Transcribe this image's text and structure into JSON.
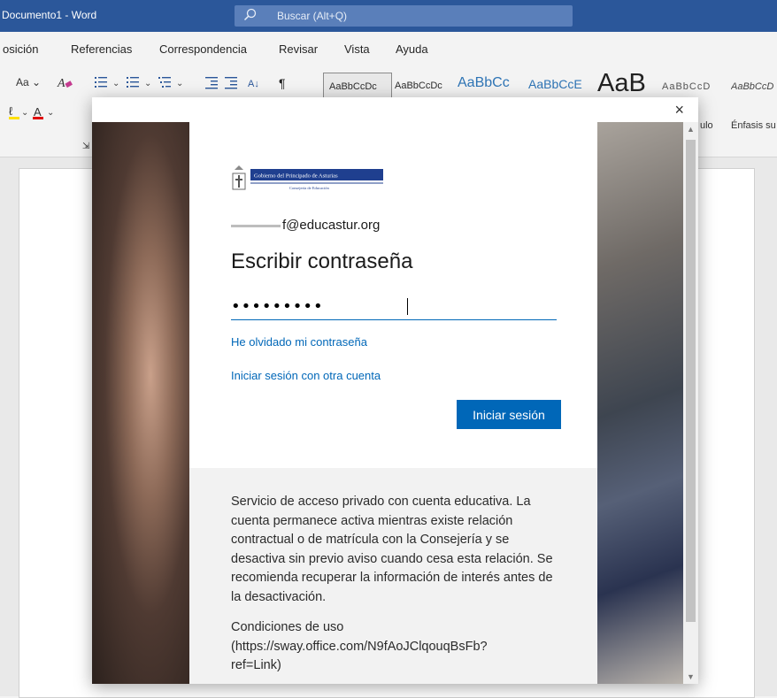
{
  "window": {
    "title": "Documento1  -  Word",
    "search_placeholder": "Buscar (Alt+Q)"
  },
  "ribbon_tabs": [
    "osición",
    "Referencias",
    "Correspondencia",
    "Revisar",
    "Vista",
    "Ayuda"
  ],
  "ribbon": {
    "font_size_label": "Aa",
    "styles": [
      "AaBbCcDc",
      "AaBbCcDc",
      "AaBbCc",
      "AaBbCcE",
      "AaB",
      "AaBbCcD",
      "AaBbCcD"
    ],
    "style_names": [
      "ulo",
      "Énfasis su"
    ]
  },
  "dialog": {
    "close_label": "×",
    "logo_line1": "Gobierno del Principado de Asturias",
    "logo_line2": "Consejería de Educación",
    "identity": "f@educastur.org",
    "heading": "Escribir contraseña",
    "password_value": "•••••••••",
    "forgot_link": "He olvidado mi contraseña",
    "other_account_link": "Iniciar sesión con otra cuenta",
    "signin_button": "Iniciar sesión",
    "info_text": "Servicio de acceso privado con cuenta educativa. La cuenta permanece activa mientras existe relación contractual o de matrícula con la Consejería y se desactiva sin previo aviso cuando cesa esta relación. Se recomienda recuperar la información de interés antes de la desactivación.",
    "terms_text": "Condiciones de uso (https://sway.office.com/N9fAoJClqouqBsFb?ref=Link)"
  },
  "colors": {
    "word_blue": "#2b579a",
    "ms_blue": "#0067b8"
  }
}
